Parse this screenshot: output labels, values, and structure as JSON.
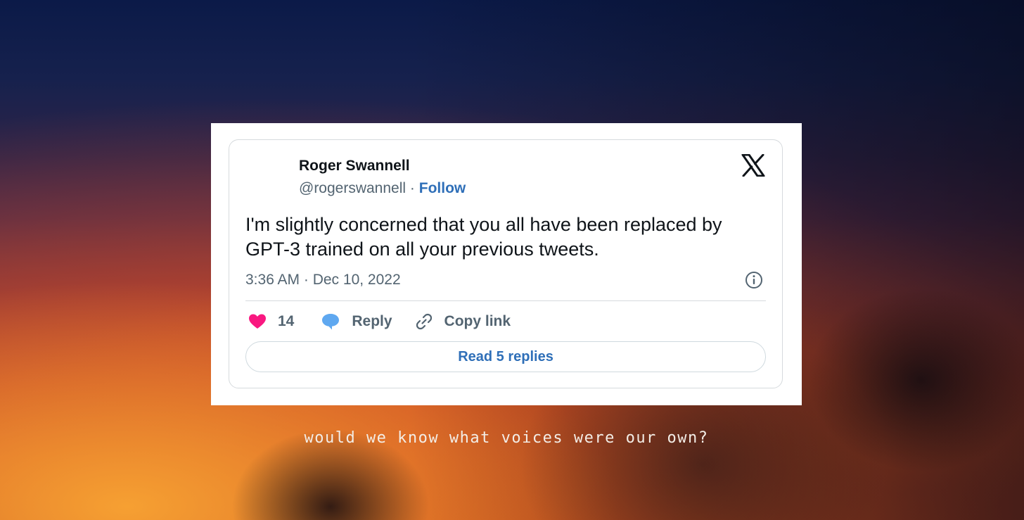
{
  "tweet": {
    "author_name": "Roger Swannell",
    "handle": "@rogerswannell",
    "separator": "·",
    "follow_label": "Follow",
    "text": "I'm slightly concerned that you all have been replaced by GPT-3 trained on all your previous tweets.",
    "timestamp": "3:36 AM · Dec 10, 2022",
    "platform_icon": "x-logo-icon",
    "info_icon": "info-icon",
    "actions": {
      "like_icon": "heart-icon",
      "like_count": "14",
      "reply_icon": "speech-bubble-icon",
      "reply_label": "Reply",
      "copy_icon": "link-icon",
      "copy_label": "Copy link"
    },
    "read_replies_label": "Read 5 replies"
  },
  "caption": "would we know what voices were our own?",
  "colors": {
    "link_blue": "#2f6fb8",
    "heart_pink": "#f91880",
    "reply_blue": "#5fa8f0",
    "text_primary": "#0f1419",
    "text_secondary": "#536471"
  }
}
